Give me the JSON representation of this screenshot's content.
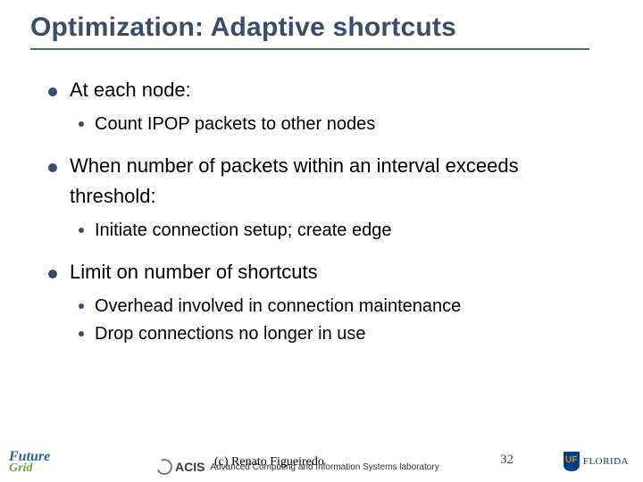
{
  "title": "Optimization: Adaptive shortcuts",
  "bullets": [
    {
      "text": "At each node:",
      "sub": [
        "Count IPOP packets to other nodes"
      ]
    },
    {
      "text": "When number of packets within an interval exceeds threshold:",
      "sub": [
        "Initiate connection setup; create edge"
      ]
    },
    {
      "text": "Limit on number of shortcuts",
      "sub": [
        "Overhead involved in connection maintenance",
        "Drop connections no longer in use"
      ]
    }
  ],
  "footer": {
    "logo_fg_line1": "Future",
    "logo_fg_line2": "Grid",
    "acis_name": "ACIS",
    "acis_lab": "Advanced Computing and Information Systems laboratory",
    "copyright": "(c) Renato Figueiredo",
    "slide_number": "32",
    "uf_shield": "UF",
    "uf_name": "FLORIDA"
  }
}
